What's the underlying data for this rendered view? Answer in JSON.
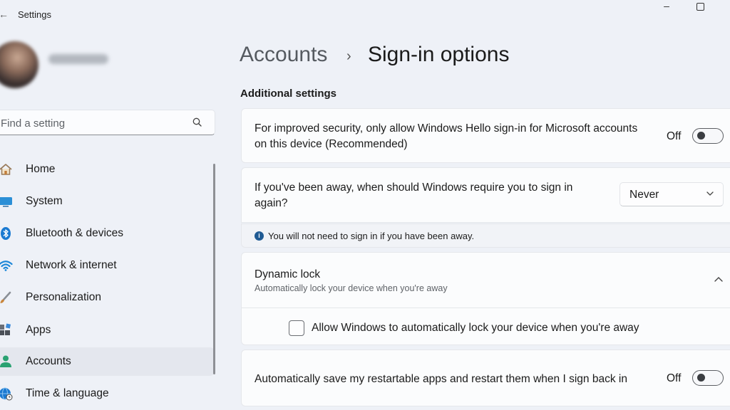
{
  "window": {
    "title": "Settings",
    "back_glyph": "←",
    "minimize_glyph": "–"
  },
  "search": {
    "placeholder": "Find a setting",
    "icon": "search-icon"
  },
  "sidebar": {
    "items": [
      {
        "label": "Home",
        "icon": "home-icon"
      },
      {
        "label": "System",
        "icon": "monitor-icon"
      },
      {
        "label": "Bluetooth & devices",
        "icon": "bluetooth-icon"
      },
      {
        "label": "Network & internet",
        "icon": "wifi-icon"
      },
      {
        "label": "Personalization",
        "icon": "brush-icon"
      },
      {
        "label": "Apps",
        "icon": "apps-icon"
      },
      {
        "label": "Accounts",
        "icon": "person-icon",
        "selected": true
      },
      {
        "label": "Time & language",
        "icon": "globe-clock-icon"
      }
    ]
  },
  "breadcrumb": {
    "parent": "Accounts",
    "separator": "›",
    "current": "Sign-in options"
  },
  "section": {
    "title": "Additional settings"
  },
  "settings": {
    "hello_only": {
      "line1": "For improved security, only allow Windows Hello sign-in for Microsoft accounts",
      "line2": "on this device (Recommended)",
      "state_label": "Off",
      "on": false
    },
    "require_signin": {
      "line1": "If you've been away, when should Windows require you to sign in",
      "line2": "again?",
      "selected": "Never",
      "info_glyph": "i",
      "info": "You will not need to sign in if you have been away."
    },
    "dynamic_lock": {
      "title": "Dynamic lock",
      "subtitle": "Automatically lock your device when you're away",
      "expanded": true,
      "checkbox_label": "Allow Windows to automatically lock your device when you're away",
      "checked": false
    },
    "restart_apps": {
      "label": "Automatically save my restartable apps and restart them when I sign back in",
      "state_label": "Off",
      "on": false
    }
  },
  "colors": {
    "background": "#eef1f7",
    "card": "#fbfcfd",
    "accent": "#1f5a93",
    "selected_nav": "#e4e7ee"
  }
}
